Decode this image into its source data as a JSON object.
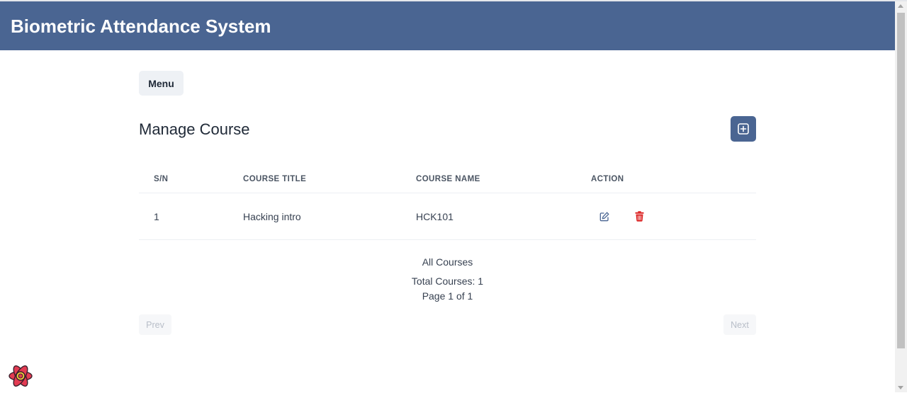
{
  "app": {
    "title": "Biometric Attendance System"
  },
  "menu_button": {
    "label": "Menu"
  },
  "page": {
    "title": "Manage Course"
  },
  "add_button": {
    "icon": "plus-square-icon"
  },
  "table": {
    "headers": [
      "S/N",
      "COURSE TITLE",
      "COURSE NAME",
      "ACTION"
    ],
    "rows": [
      {
        "sn": "1",
        "title": "Hacking intro",
        "name": "HCK101"
      }
    ]
  },
  "summary": {
    "caption": "All Courses",
    "total": "Total Courses: 1",
    "page": "Page 1 of 1"
  },
  "pagination": {
    "prev": "Prev",
    "next": "Next"
  },
  "colors": {
    "header": "#4a6592",
    "delete": "#dc2626",
    "edit": "#4a6592"
  }
}
